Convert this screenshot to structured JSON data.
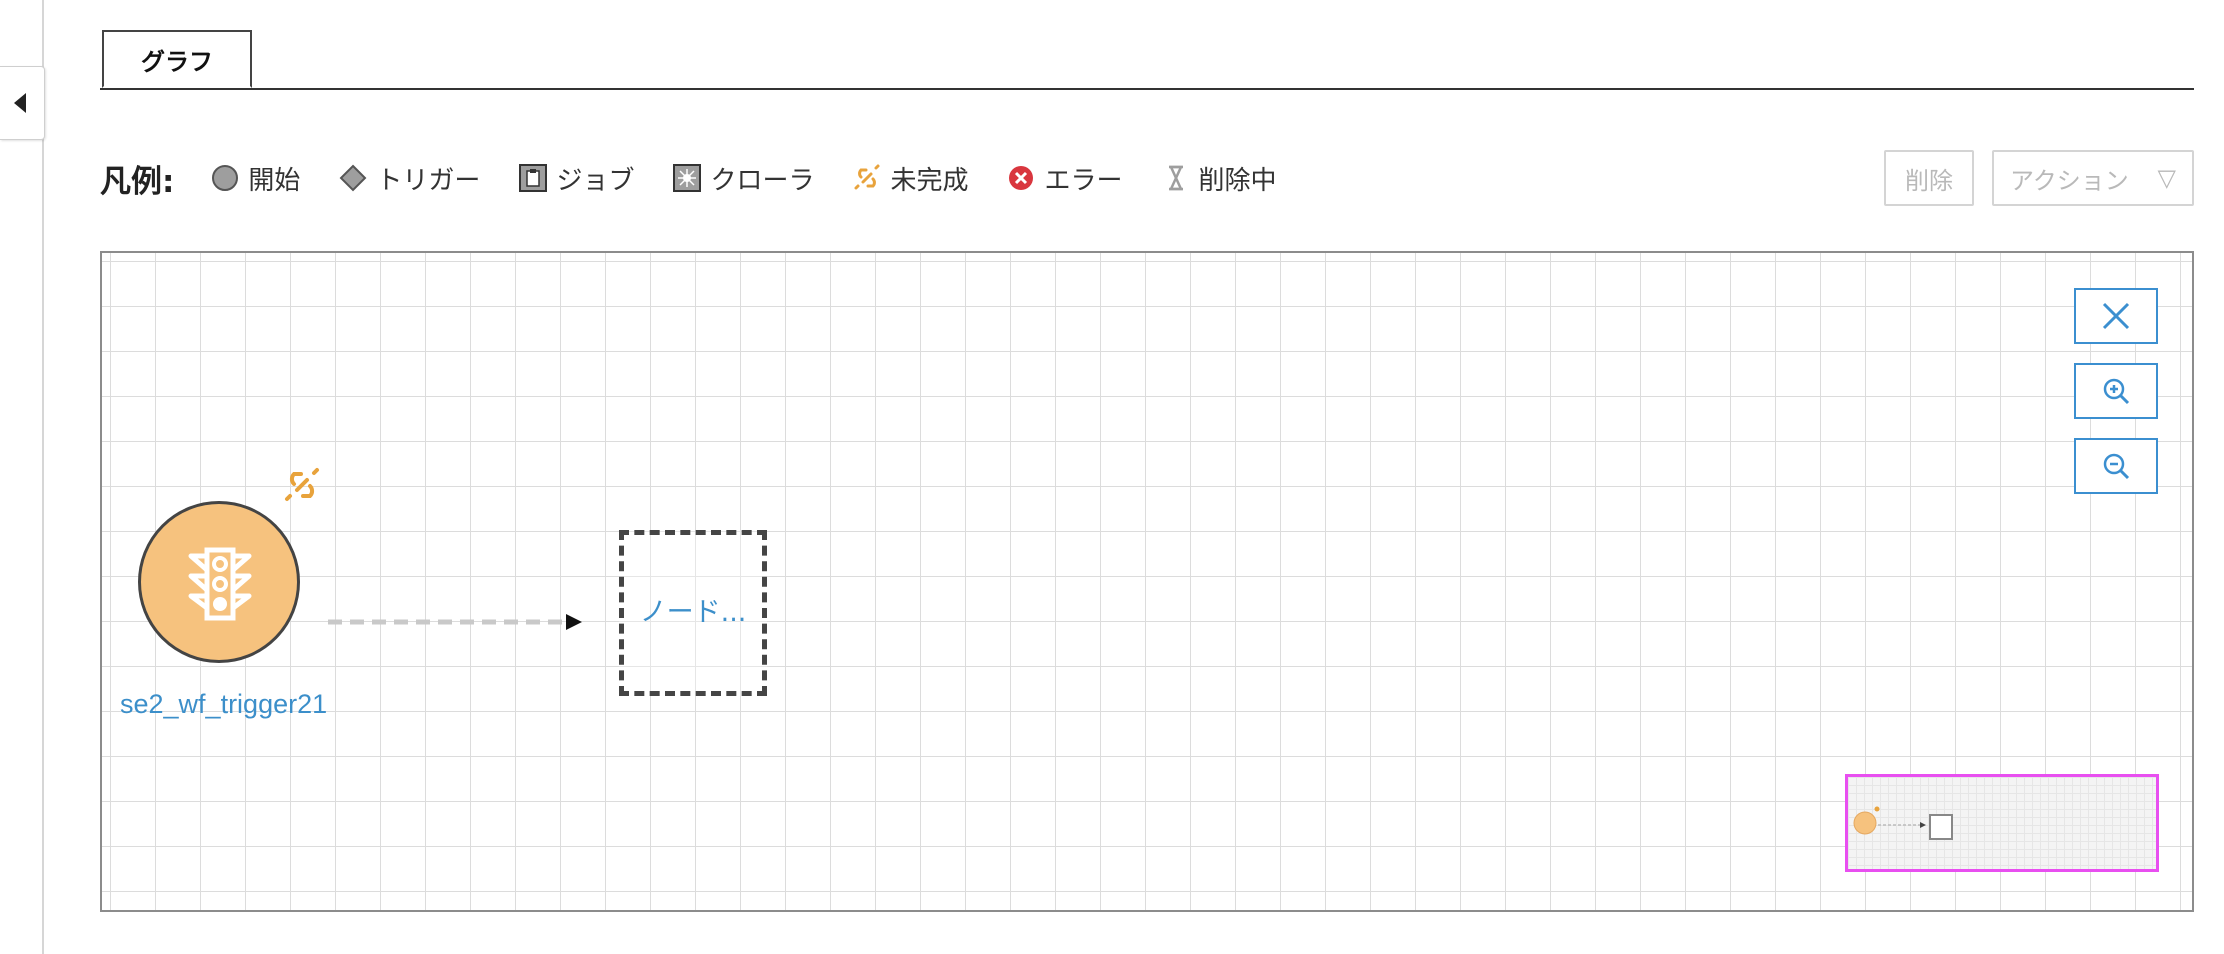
{
  "tabs": [
    {
      "label": "グラフ",
      "active": true
    }
  ],
  "legend": {
    "title": "凡例:",
    "items": [
      {
        "label": "開始",
        "icon": "circle-icon"
      },
      {
        "label": "トリガー",
        "icon": "diamond-icon"
      },
      {
        "label": "ジョブ",
        "icon": "clipboard-icon"
      },
      {
        "label": "クローラ",
        "icon": "crawler-icon"
      },
      {
        "label": "未完成",
        "icon": "broken-link-icon"
      },
      {
        "label": "エラー",
        "icon": "error-icon"
      },
      {
        "label": "削除中",
        "icon": "hourglass-icon"
      }
    ]
  },
  "actions": {
    "delete_label": "削除",
    "actions_label": "アクション",
    "actions_caret": "▽"
  },
  "graph": {
    "start_node": {
      "label": "se2_wf_trigger21",
      "icon": "traffic-light-icon",
      "fill_color": "#f6c27e",
      "status": "incomplete"
    },
    "placeholder_node": {
      "label": "ノード..."
    },
    "controls": [
      {
        "name": "reset-zoom-button",
        "icon": "close-icon"
      },
      {
        "name": "zoom-in-button",
        "icon": "zoom-in-icon"
      },
      {
        "name": "zoom-out-button",
        "icon": "zoom-out-icon"
      }
    ]
  },
  "colors": {
    "accent": "#3b8fd0",
    "node_fill": "#f6c27e",
    "incomplete": "#e8a33c",
    "error": "#d9363e",
    "minimap_border": "#e84ff0"
  }
}
